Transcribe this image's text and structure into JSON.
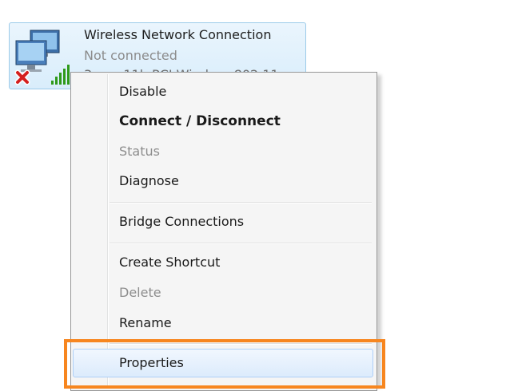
{
  "connection": {
    "name": "Wireless Network Connection",
    "status": "Not connected",
    "adapter_partial": "3com 11b PCI Wireless 802.11",
    "icon": "network-computer-icon",
    "status_icon": "red-x-icon",
    "signal_icon": "signal-bars-icon"
  },
  "context_menu": {
    "items": [
      {
        "label": "Disable",
        "state": "normal"
      },
      {
        "label": "Connect / Disconnect",
        "state": "default-bold"
      },
      {
        "label": "Status",
        "state": "disabled"
      },
      {
        "label": "Diagnose",
        "state": "normal"
      },
      {
        "label": "Bridge Connections",
        "state": "normal"
      },
      {
        "label": "Create Shortcut",
        "state": "normal"
      },
      {
        "label": "Delete",
        "state": "disabled"
      },
      {
        "label": "Rename",
        "state": "normal"
      },
      {
        "label": "Properties",
        "state": "hovered"
      }
    ]
  },
  "colors": {
    "highlight": "#f7861f",
    "tile_border": "#9ccbe9",
    "disabled_text": "#8d8d8d"
  }
}
